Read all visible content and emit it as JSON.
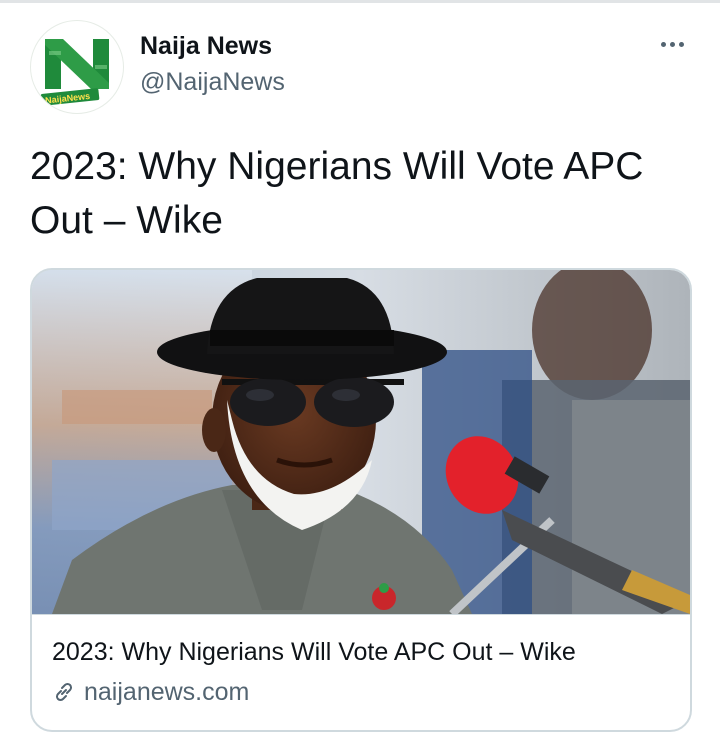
{
  "tweet": {
    "author": {
      "display_name": "Naija News",
      "handle": "@NaijaNews",
      "avatar_logo_text": "NaijaNews"
    },
    "text": "2023: Why Nigerians Will Vote APC Out – Wike",
    "more_icon": "more-horizontal-icon"
  },
  "card": {
    "title": "2023: Why Nigerians Will Vote APC Out – Wike",
    "domain": "naijanews.com",
    "domain_icon": "link-icon",
    "image_description_icon": "news-photo"
  },
  "colors": {
    "brand_green": "#1f8a3b",
    "text_primary": "#0f1419",
    "text_secondary": "#536471",
    "border": "#cfd9de"
  }
}
